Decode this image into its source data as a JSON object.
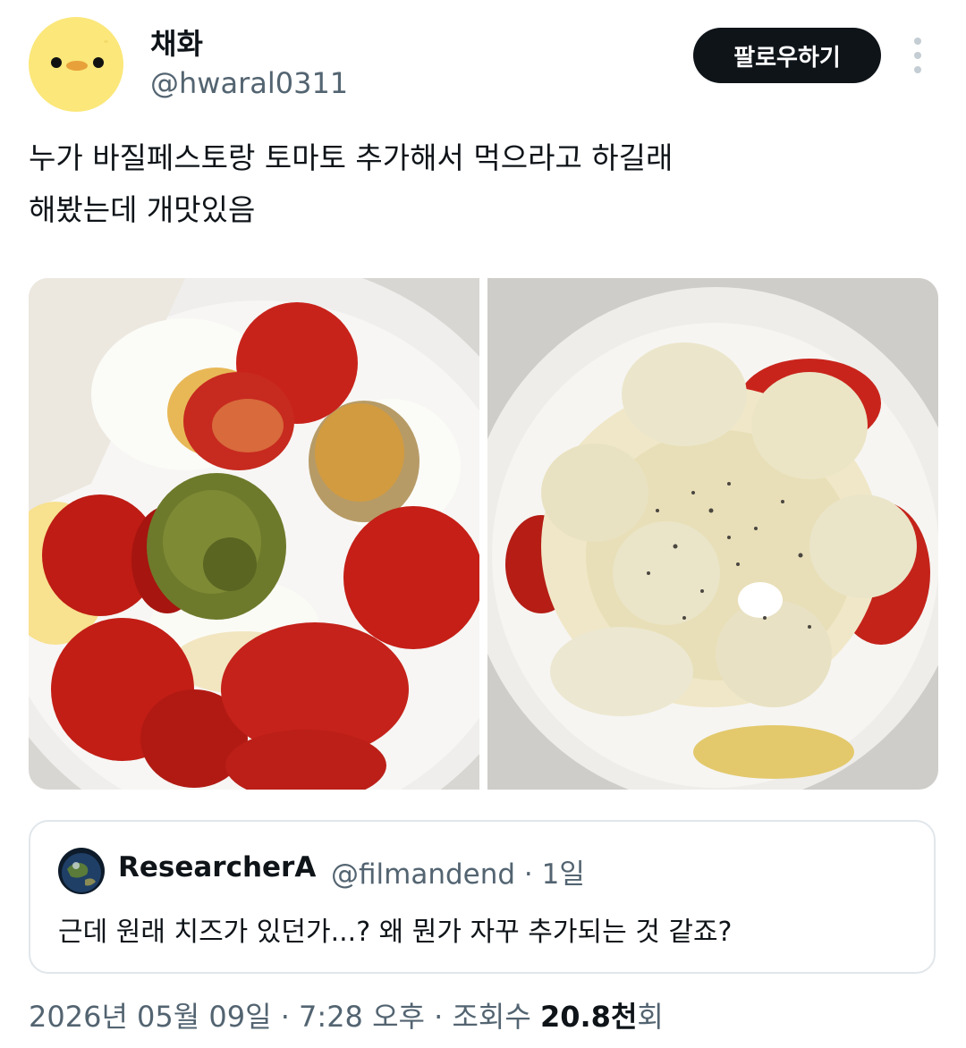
{
  "author": {
    "name": "채화",
    "handle": "@hwaral0311",
    "avatar_icon": "chick-face-avatar"
  },
  "follow_label": "팔로우하기",
  "more_icon": "vertical-ellipsis-icon",
  "tweet_text": "누가 바질페스토랑 토마토 추가해서 먹으라고 하길래\n해봤는데 개맛있음",
  "media": [
    {
      "alt": "삶은 달걀, 방울토마토, 바질페스토가 담긴 그릇"
    },
    {
      "alt": "마요네즈와 후추를 뿌린 달걀 토마토 샐러드 그릇"
    }
  ],
  "quote": {
    "name": "ResearcherA",
    "meta": "@filmandend · 1일",
    "text": "근데 원래 치즈가 있던가...? 왜 뭔가 자꾸 추가되는 것 같죠?"
  },
  "footer": {
    "date_time": "2026년 05월 09일 · 7:28 오후 · 조회수 ",
    "views": "20.8천",
    "views_suffix": "회"
  },
  "colors": {
    "text": "#0f1419",
    "secondary": "#536471",
    "follow_bg": "#0f1419",
    "border": "#e1e6ea"
  }
}
